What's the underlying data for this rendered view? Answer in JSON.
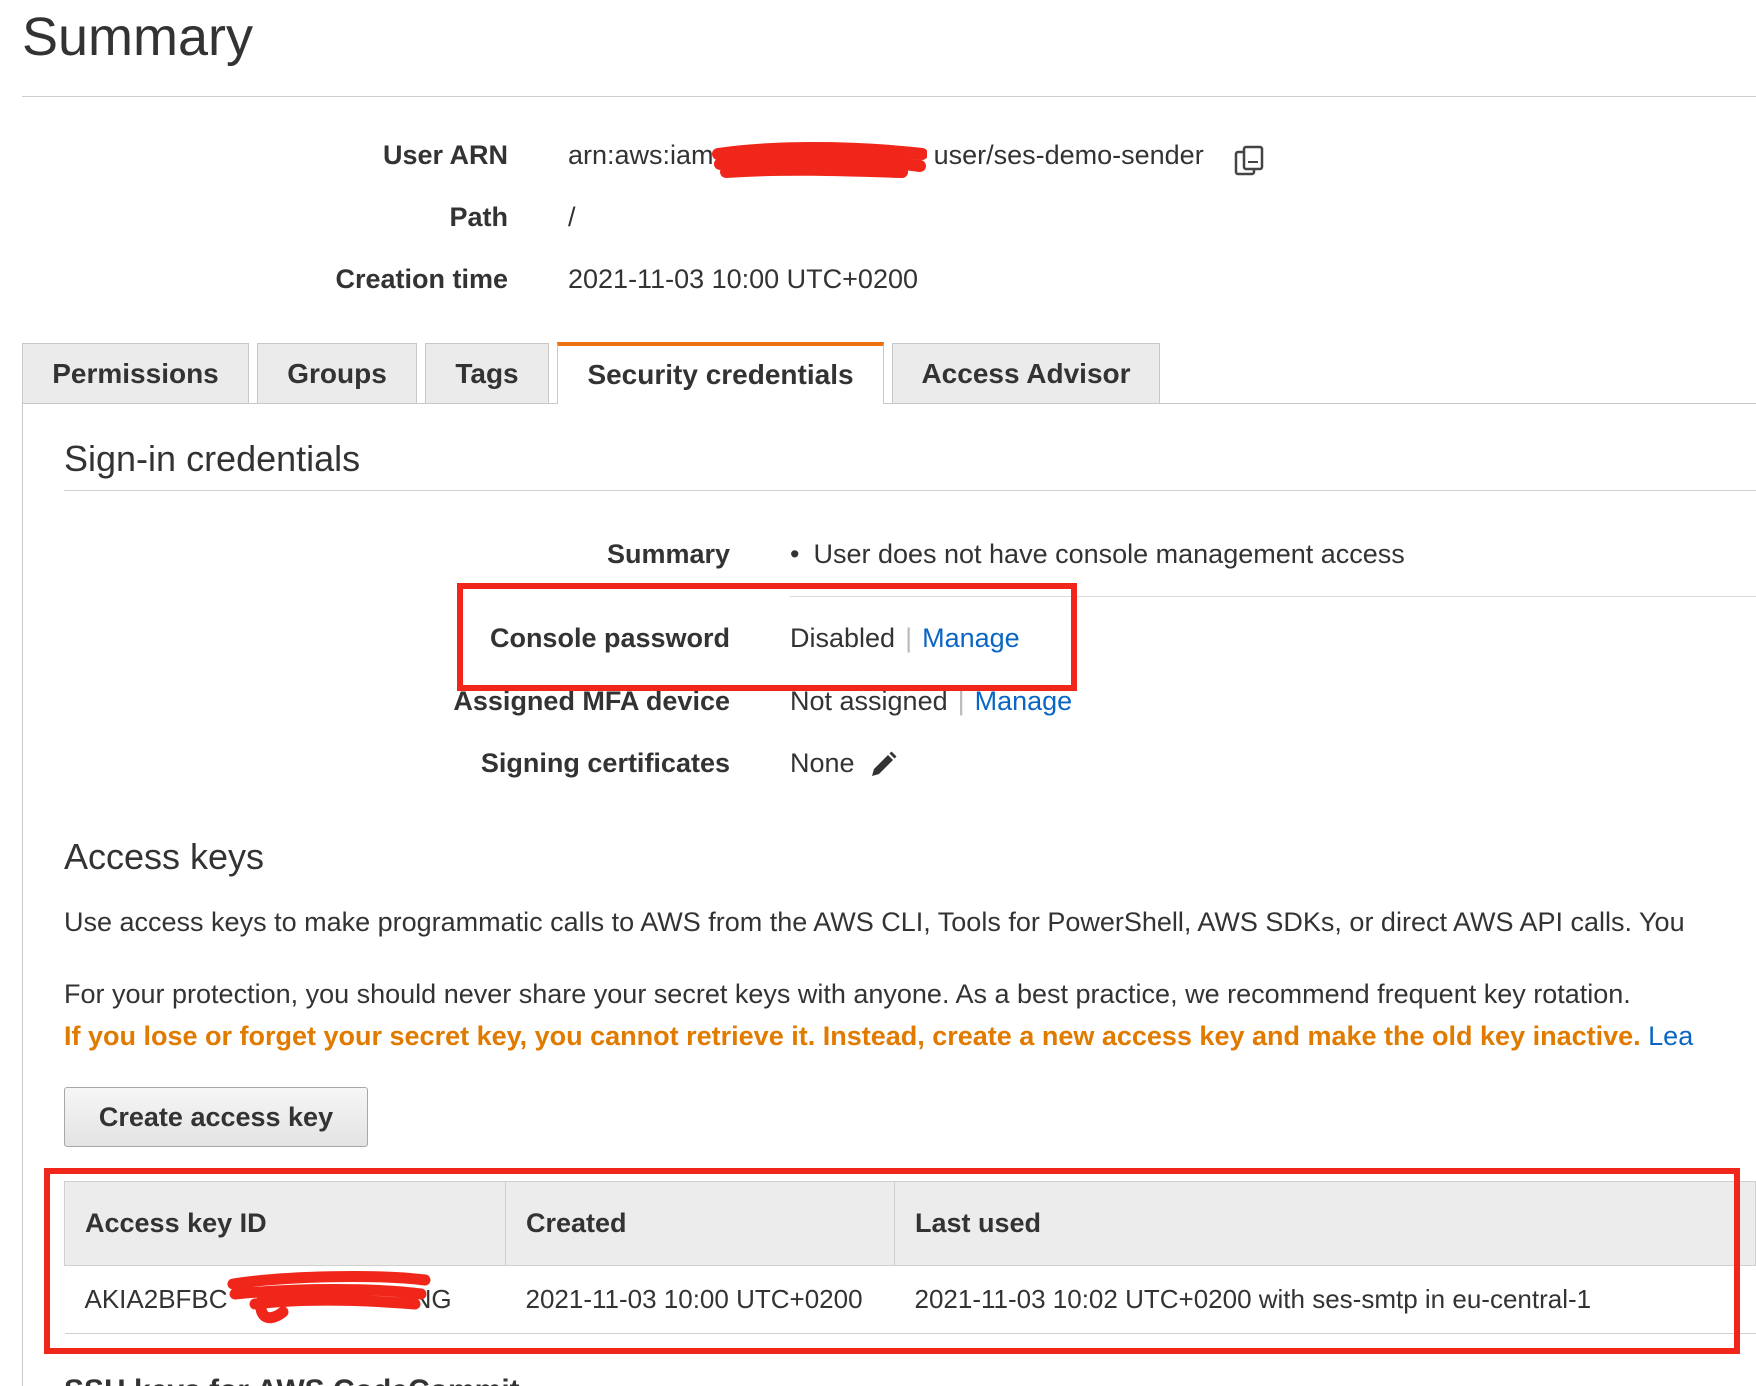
{
  "page": {
    "title": "Summary"
  },
  "summary": {
    "user_arn_label": "User ARN",
    "user_arn_prefix": "arn:aws:iam::",
    "user_arn_suffix": "user/ses-demo-sender",
    "path_label": "Path",
    "path_value": "/",
    "creation_time_label": "Creation time",
    "creation_time_value": "2021-11-03 10:00 UTC+0200"
  },
  "tabs": [
    {
      "label": "Permissions",
      "active": false
    },
    {
      "label": "Groups",
      "active": false
    },
    {
      "label": "Tags",
      "active": false
    },
    {
      "label": "Security credentials",
      "active": true
    },
    {
      "label": "Access Advisor",
      "active": false
    }
  ],
  "signin": {
    "title": "Sign-in credentials",
    "summary_label": "Summary",
    "summary_value": "User does not have console management access",
    "console_password_label": "Console password",
    "console_password_value": "Disabled",
    "mfa_label": "Assigned MFA device",
    "mfa_value": "Not assigned",
    "manage_link": "Manage",
    "signing_label": "Signing certificates",
    "signing_value": "None"
  },
  "access_keys": {
    "title": "Access keys",
    "description": "Use access keys to make programmatic calls to AWS from the AWS CLI, Tools for PowerShell, AWS SDKs, or direct AWS API calls. You",
    "protection": "For your protection, you should never share your secret keys with anyone. As a best practice, we recommend frequent key rotation.",
    "warning": "If you lose or forget your secret key, you cannot retrieve it. Instead, create a new access key and make the old key inactive.",
    "learn_more": "Lea",
    "create_button": "Create access key",
    "columns": [
      "Access key ID",
      "Created",
      "Last used"
    ],
    "rows": [
      {
        "key_id_prefix": "AKIA2BFBC",
        "key_id_suffix": "NG",
        "created": "2021-11-03 10:00 UTC+0200",
        "last_used": "2021-11-03 10:02 UTC+0200 with ses-smtp in eu-central-1"
      }
    ]
  },
  "next_section_title": "SSH keys for AWS CodeCommit",
  "colors": {
    "accent_orange": "#ec7211",
    "warning_orange": "#e07b00",
    "link_blue": "#0a66c2",
    "highlight_red": "#f0261b"
  }
}
